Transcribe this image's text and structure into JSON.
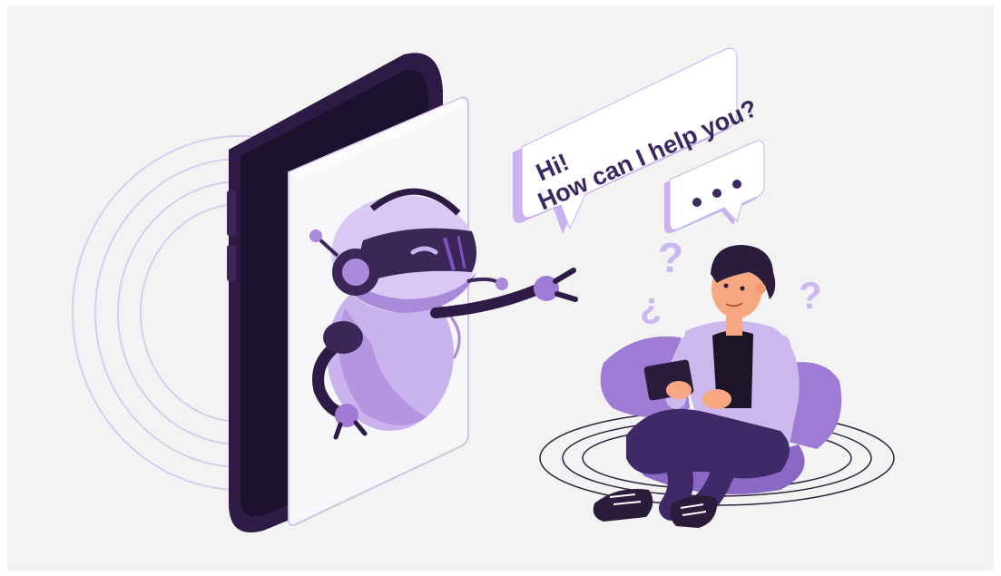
{
  "bubble_main": {
    "line1": "Hi!",
    "line2": "How can I help you?"
  },
  "bubble_typing": {
    "dots": "• • •"
  },
  "question_marks": {
    "q1": "?",
    "q2": "¿",
    "q3": "?"
  },
  "colors": {
    "background": "#f3f3f3",
    "phone_body": "#2d1b46",
    "screen": "#f6f6f8",
    "robot_body": "#c9b3ee",
    "robot_shade": "#a98ad8",
    "accent_purple": "#7e52c0",
    "dark_purple": "#3b2658",
    "shirt": "#cdb8ee",
    "pants": "#3f2a68",
    "cushion": "#9f7bd6",
    "skin": "#f6a981",
    "hair": "#2a1c3a",
    "lines": "#d9cdee"
  }
}
